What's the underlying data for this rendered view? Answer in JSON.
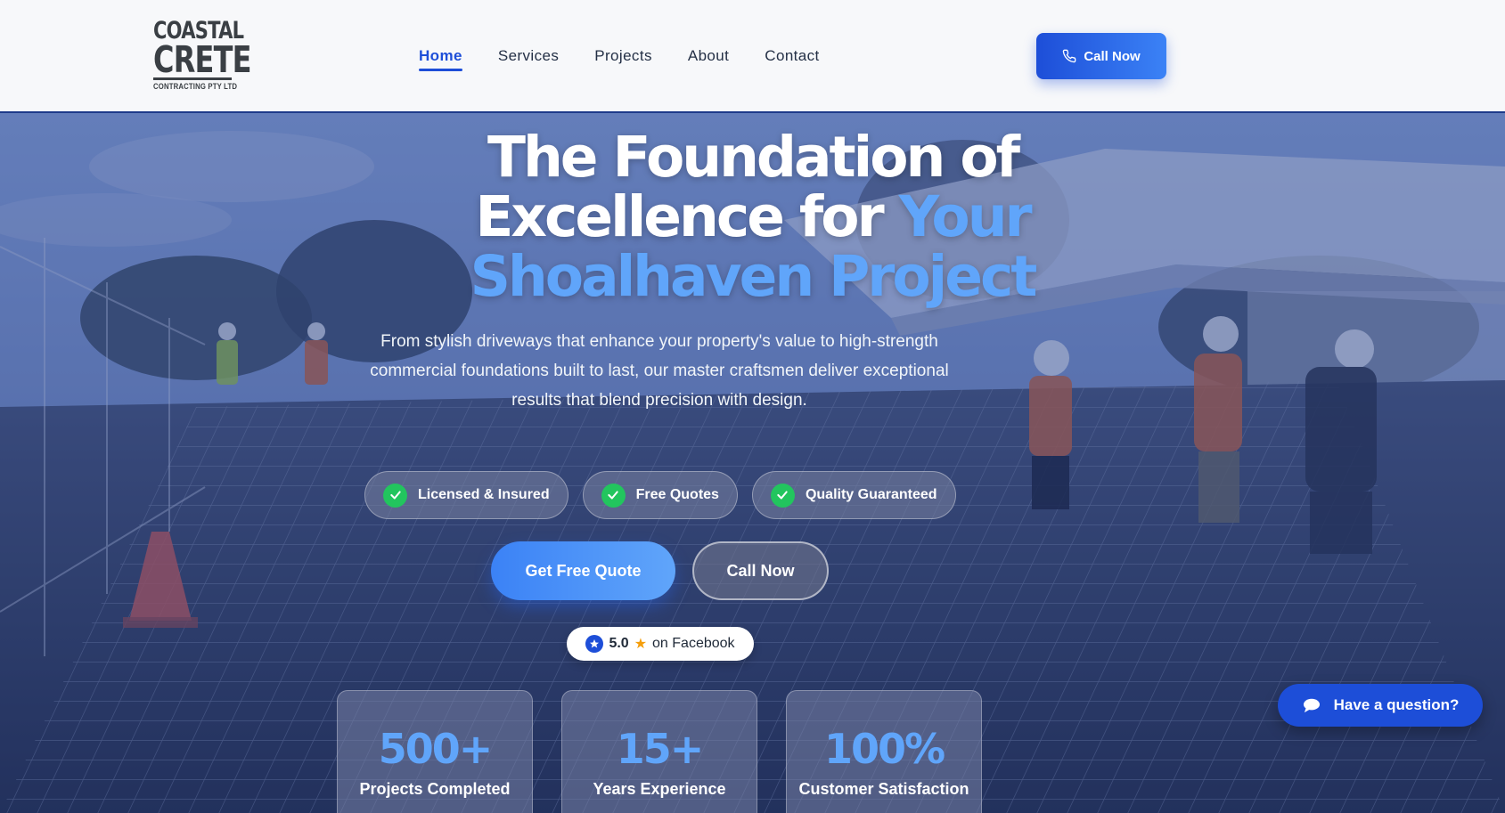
{
  "brand": {
    "line1": "COASTAL",
    "line2": "CRETE",
    "line3": "CONTRACTING PTY LTD"
  },
  "nav": {
    "items": [
      {
        "label": "Home",
        "active": true
      },
      {
        "label": "Services",
        "active": false
      },
      {
        "label": "Projects",
        "active": false
      },
      {
        "label": "About",
        "active": false
      },
      {
        "label": "Contact",
        "active": false
      }
    ],
    "call_label": "Call Now",
    "call_icon": "phone-icon"
  },
  "hero": {
    "title_part1": "The Foundation of",
    "title_part2a": "Excellence for ",
    "title_part2b": "Your",
    "title_part3": "Shoalhaven Project",
    "subtitle": "From stylish driveways that enhance your property's value to high-strength commercial foundations built to last, our master craftsmen deliver exceptional results that blend precision with design.",
    "badges": [
      {
        "label": "Licensed & Insured",
        "icon": "check-icon"
      },
      {
        "label": "Free Quotes",
        "icon": "check-icon"
      },
      {
        "label": "Quality Guaranteed",
        "icon": "check-icon"
      }
    ],
    "primary_cta": "Get Free Quote",
    "secondary_cta": "Call Now",
    "rating": {
      "score": "5.0",
      "star": "★",
      "source": "on Facebook",
      "icon": "facebook-star-icon"
    },
    "stats": [
      {
        "value": "500+",
        "label": "Projects Completed"
      },
      {
        "value": "15+",
        "label": "Years Experience"
      },
      {
        "value": "100%",
        "label": "Customer Satisfaction"
      }
    ]
  },
  "chat": {
    "label": "Have a question?",
    "icon": "chat-bubble-icon"
  },
  "colors": {
    "accent": "#3b82f6",
    "accent_light": "#60a5fa",
    "brand_dark": "#1d4ed8",
    "check": "#22c55e"
  }
}
